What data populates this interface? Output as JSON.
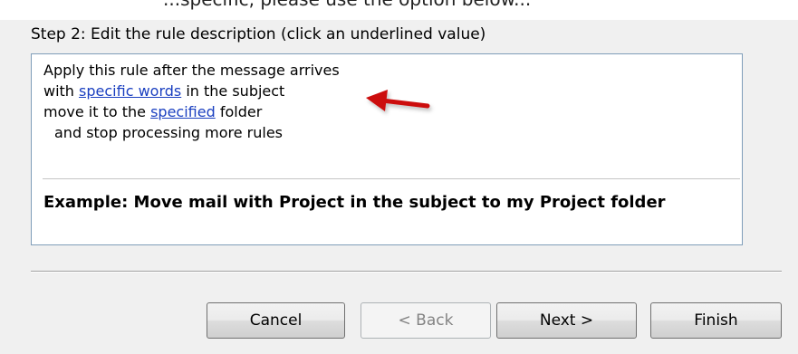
{
  "header": {
    "partial_text": "...specific, please use the option below..."
  },
  "step": {
    "label": "Step 2: Edit the rule description (click an underlined value)"
  },
  "rule": {
    "line1": "Apply this rule after the message arrives",
    "line2_prefix": "with ",
    "line2_link": "specific words",
    "line2_suffix": " in the subject",
    "line3_prefix": "move it to the ",
    "line3_link": "specified",
    "line3_suffix": " folder",
    "line4": "and stop processing more rules",
    "example": "Example: Move mail with Project in the subject to my Project folder"
  },
  "buttons": {
    "cancel": "Cancel",
    "back": "< Back",
    "next": "Next >",
    "finish": "Finish"
  },
  "colors": {
    "link": "#1a3fc0",
    "arrow": "#cc1111"
  }
}
